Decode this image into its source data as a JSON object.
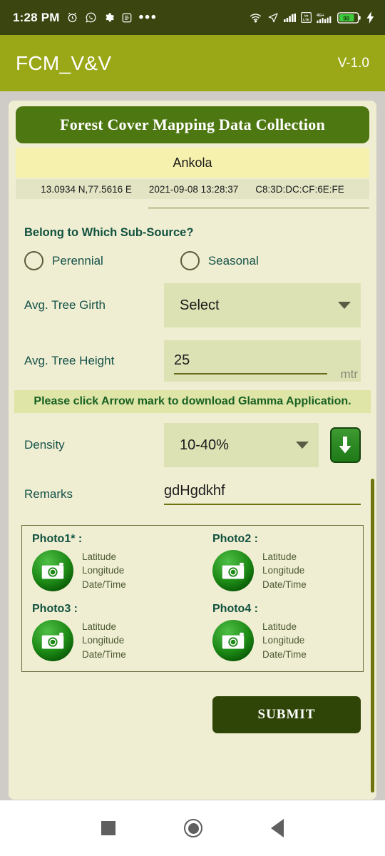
{
  "status_bar": {
    "time": "1:28 PM",
    "left_icons": [
      "alarm-icon",
      "whatsapp-icon",
      "gear-icon",
      "app-icon",
      "more-icon"
    ],
    "right_icons": [
      "wifi-icon",
      "location-arrow-icon",
      "signal-icon",
      "volte-icon",
      "4g-plus-icon",
      "battery-icon",
      "charging-icon"
    ],
    "volte_label": "Vo LTE",
    "network_label": "4G+",
    "battery_level": "90"
  },
  "app_bar": {
    "title": "FCM_V&V",
    "version": "V-1.0",
    "background": "#9aa717"
  },
  "card": {
    "title": "Forest Cover Mapping Data Collection",
    "place": "Ankola",
    "meta": {
      "coordinates": "13.0934 N,77.5616 E",
      "datetime": "2021-09-08 13:28:37",
      "device_id": "C8:3D:DC:CF:6E:FE"
    }
  },
  "form": {
    "sub_source_question": "Belong to Which Sub-Source?",
    "sub_source_options": [
      {
        "label": "Perennial",
        "selected": false
      },
      {
        "label": "Seasonal",
        "selected": false
      }
    ],
    "tree_girth": {
      "label": "Avg. Tree Girth",
      "value": "Select",
      "options": [
        "Select"
      ]
    },
    "tree_height": {
      "label": "Avg. Tree Height",
      "value": "25",
      "unit": "mtr"
    },
    "banner": "Please click Arrow mark to download Glamma Application.",
    "density": {
      "label": "Density",
      "value": "10-40%",
      "options": [
        "10-40%"
      ]
    },
    "download_button": "download-arrow",
    "remarks": {
      "label": "Remarks",
      "value": "gdHgdkhf"
    }
  },
  "photos": [
    {
      "title": "Photo1* :",
      "meta": [
        "Latitude",
        "Longitude",
        "Date/Time"
      ]
    },
    {
      "title": "Photo2 :",
      "meta": [
        "Latitude",
        "Longitude",
        "Date/Time"
      ]
    },
    {
      "title": "Photo3 :",
      "meta": [
        "Latitude",
        "Longitude",
        "Date/Time"
      ]
    },
    {
      "title": "Photo4 :",
      "meta": [
        "Latitude",
        "Longitude",
        "Date/Time"
      ]
    }
  ],
  "submit": {
    "label": "SUBMIT"
  },
  "nav_bar": {
    "recents": "recents-square-icon",
    "home": "home-circle-icon",
    "back": "back-triangle-icon"
  },
  "colors": {
    "status_bar": "#3b4510",
    "app_bar": "#9aa717",
    "card_bg": "#f0eed2",
    "card_title_bg": "#4d7711",
    "place_bg": "#f6f1ac",
    "field_bg": "#dde2b4",
    "accent_text": "#10513f",
    "submit_bg": "#2f4407"
  }
}
